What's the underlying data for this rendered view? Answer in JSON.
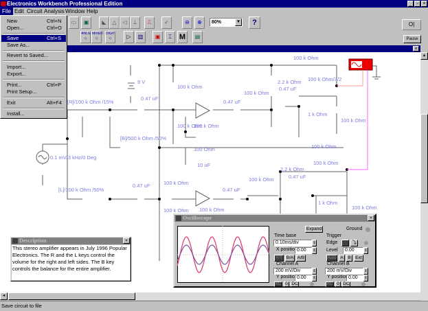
{
  "app": {
    "title": "Electronics Workbench Professional Edition"
  },
  "menubar": [
    "File",
    "Edit",
    "Circuit",
    "Analysis",
    "Window",
    "Help"
  ],
  "file_menu": [
    {
      "label": "New",
      "shortcut": "Ctrl+N"
    },
    {
      "label": "Open...",
      "shortcut": "Ctrl+O"
    },
    {
      "label": "Save",
      "shortcut": "Ctrl+S",
      "selected": true
    },
    {
      "label": "Save As...",
      "shortcut": ""
    },
    {
      "label": "Revert to Saved...",
      "shortcut": ""
    },
    {
      "label": "Import...",
      "shortcut": ""
    },
    {
      "label": "Export...",
      "shortcut": ""
    },
    {
      "label": "Print...",
      "shortcut": "Ctrl+P"
    },
    {
      "label": "Print Setup...",
      "shortcut": ""
    },
    {
      "label": "Exit",
      "shortcut": "Alt+F4"
    },
    {
      "label": "Install...",
      "shortcut": ""
    }
  ],
  "toolbar": {
    "zoom_value": "80%",
    "help": "?",
    "pause": "Pause",
    "parts_bins": [
      "ANLG",
      "MIXED",
      "DIGIT"
    ],
    "meter_label": "M"
  },
  "schematic_labels": [
    "9 V",
    "100 k Ohm",
    "0.47 uF",
    "[R]/100 k Ohm /15%",
    "[B]/500 k Ohm /50%",
    "0.1 mV/3 kHz/0 Deg",
    "100 k Ohm",
    "100 k Ohm",
    "100 Ohm",
    "10 uF",
    "[L]/100 k Ohm /50%",
    "0.47 uF",
    "100 k Ohm",
    "100 k Ohm",
    "100 k Ohm",
    "100 k Ohm",
    "2.2 k Ohm",
    "0.47 uF",
    "100 k Ohm",
    "100 k Ohm/3/2",
    "0.47 uF",
    "1 k Ohm",
    "100 k Ohm",
    "100 k Ohm",
    "100 k Ohm",
    "2.2 k Ohm",
    "0.47 uF",
    "100 k Ohm",
    "0.47 uF",
    "1 k Ohm",
    "100 k Ohm"
  ],
  "description": {
    "title": "Description",
    "text": "This stereo amplifier appears in July 1996 Popular Electronics.  The R and the L keys control the volume for the right and left sides. The B key controls the balance for the entire amplifier."
  },
  "oscilloscope": {
    "title": "Oscilloscope",
    "expand": "Expand",
    "ground": "Ground",
    "time_base": {
      "label": "Time base",
      "value": "0.10ms/div",
      "x_position_label": "X position",
      "x_position": "0.00",
      "modes": [
        "Y/T",
        "B/A",
        "A/B"
      ]
    },
    "trigger": {
      "label": "Trigger",
      "edge_label": "Edge",
      "level_label": "Level",
      "level": "0.00",
      "sources": [
        "Auto",
        "A",
        "B",
        "Ext"
      ]
    },
    "channel_a": {
      "label": "Channel A",
      "value": "200 mV/Div",
      "y_position_label": "Y position",
      "y_position": "0.00",
      "coupling": [
        "AC",
        "0",
        "DC"
      ]
    },
    "channel_b": {
      "label": "Channel B",
      "value": "200 mV/Div",
      "y_position_label": "Y position",
      "y_position": "0.00",
      "coupling": [
        "AC",
        "0",
        "DC"
      ]
    },
    "trace_colors": {
      "a": "#e04070",
      "b": "#8050a0"
    }
  },
  "status": "Save circuit to file",
  "colors": {
    "titlebar": "#000080",
    "label": "#7b7be0",
    "wire": "#606060",
    "probe_wire": "#ff66ff"
  }
}
